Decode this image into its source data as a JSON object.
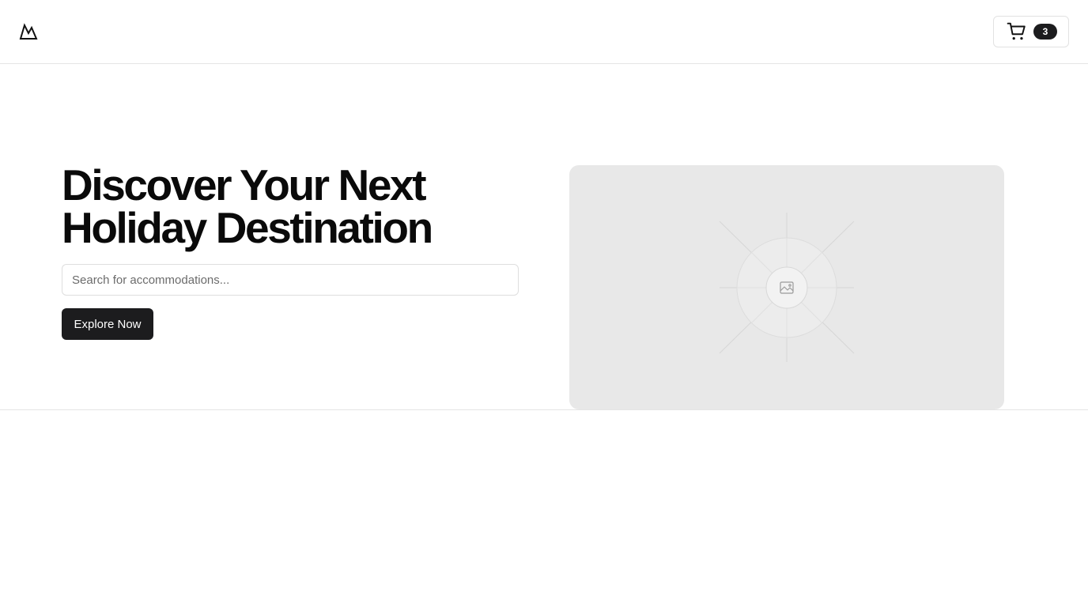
{
  "header": {
    "logo_icon": "mountain-logo-icon",
    "cart": {
      "icon": "shopping-cart-icon",
      "count": "3"
    }
  },
  "hero": {
    "title": "Discover Your Next Holiday Destination",
    "search": {
      "placeholder": "Search for accommodations...",
      "value": ""
    },
    "cta_label": "Explore Now",
    "image_icon": "image-placeholder-icon"
  },
  "colors": {
    "primary": "#1c1c1e",
    "border": "#e5e5e5",
    "image_placeholder_bg": "#e8e8e8"
  }
}
